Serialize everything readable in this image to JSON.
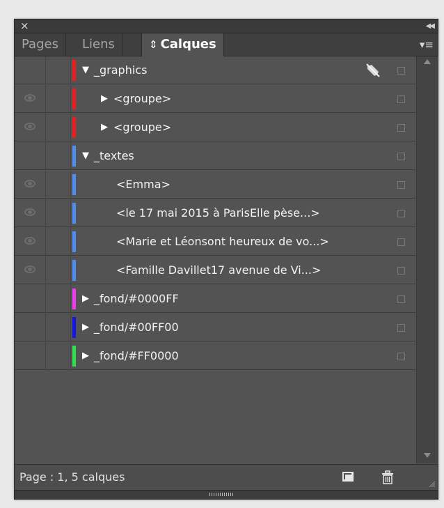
{
  "titlebar": {
    "close_icon": "close-x-icon",
    "collapse_icon": "collapse-double-arrow-icon"
  },
  "tabs": [
    {
      "label": "Pages",
      "active": false
    },
    {
      "label": "Liens",
      "active": false
    },
    {
      "label": "Calques",
      "active": true,
      "prefix_icon": "up-down-arrows-icon"
    }
  ],
  "tab_updown_glyph": "⇕",
  "panel_menu_icon": "panel-menu-icon",
  "layers": [
    {
      "label": "_graphics",
      "color": "#ee1c1c",
      "visible": false,
      "expanded": true,
      "level": 0,
      "pinned": true
    },
    {
      "label": "<groupe>",
      "color": "#ee1c1c",
      "visible": true,
      "expanded": false,
      "level": 1
    },
    {
      "label": "<groupe>",
      "color": "#ee1c1c",
      "visible": true,
      "expanded": false,
      "level": 1
    },
    {
      "label": "_textes",
      "color": "#4e8ef2",
      "visible": false,
      "expanded": true,
      "level": 0
    },
    {
      "label": "<Emma>",
      "color": "#4e8ef2",
      "visible": true,
      "level": 2
    },
    {
      "label": "<le 17 mai 2015 à ParisElle pèse...>",
      "color": "#4e8ef2",
      "visible": true,
      "level": 2
    },
    {
      "label": "<Marie et Léonsont heureux de vo...>",
      "color": "#4e8ef2",
      "visible": true,
      "level": 2
    },
    {
      "label": "<Famille Davillet17 avenue de Vi...>",
      "color": "#4e8ef2",
      "visible": true,
      "level": 2
    },
    {
      "label": "_fond/#0000FF",
      "color": "#f03cf0",
      "visible": false,
      "expanded": false,
      "level": 0
    },
    {
      "label": "_fond/#00FF00",
      "color": "#1515e8",
      "visible": false,
      "expanded": false,
      "level": 0
    },
    {
      "label": "_fond/#FF0000",
      "color": "#2ee04a",
      "visible": false,
      "expanded": false,
      "level": 0
    }
  ],
  "footer": {
    "status": "Page : 1, 5 calques",
    "new_layer_icon": "new-layer-icon",
    "trash_icon": "trash-icon"
  }
}
